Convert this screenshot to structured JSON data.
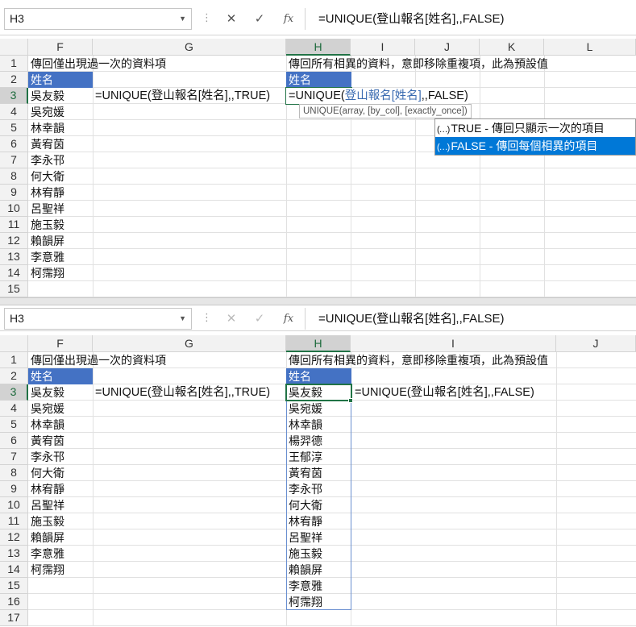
{
  "top": {
    "namebox": "H3",
    "formula": "=UNIQUE(登山報名[姓名],,FALSE)",
    "columns": [
      "F",
      "G",
      "H",
      "I",
      "J",
      "K",
      "L"
    ],
    "rows": [
      "1",
      "2",
      "3",
      "4",
      "5",
      "6",
      "7",
      "8",
      "9",
      "10",
      "11",
      "12",
      "13",
      "14",
      "15"
    ],
    "f1": "傳回僅出現過一次的資料項",
    "h1": "傳回所有相異的資料，意即移除重複項，此為預設值",
    "header_name": "姓名",
    "g3": "=UNIQUE(登山報名[姓名],,TRUE)",
    "h3_prefix": "=UNIQUE(",
    "h3_ref": "登山報名[姓名]",
    "h3_suffix": ",,FALSE)",
    "names": [
      "吳友毅",
      "吳宛媛",
      "林幸韻",
      "黃宥茵",
      "李永邗",
      "何大衛",
      "林宥靜",
      "呂聖祥",
      "施玉毅",
      "賴韻屏",
      "李意雅",
      "柯霈翔"
    ],
    "tooltip": "UNIQUE(array, [by_col], [exactly_once])",
    "autocomplete": [
      {
        "icon": "(…)",
        "label": "TRUE - 傳回只顯示一次的項目"
      },
      {
        "icon": "(…)",
        "label": "FALSE - 傳回每個相異的項目"
      }
    ]
  },
  "bottom": {
    "namebox": "H3",
    "formula": "=UNIQUE(登山報名[姓名],,FALSE)",
    "columns": [
      "F",
      "G",
      "H",
      "I",
      "J"
    ],
    "rows": [
      "1",
      "2",
      "3",
      "4",
      "5",
      "6",
      "7",
      "8",
      "9",
      "10",
      "11",
      "12",
      "13",
      "14",
      "15",
      "16",
      "17"
    ],
    "f1": "傳回僅出現過一次的資料項",
    "h1": "傳回所有相異的資料，意即移除重複項，此為預設值",
    "header_name": "姓名",
    "g3": "=UNIQUE(登山報名[姓名],,TRUE)",
    "i3": "=UNIQUE(登山報名[姓名],,FALSE)",
    "names": [
      "吳友毅",
      "吳宛媛",
      "林幸韻",
      "黃宥茵",
      "李永邗",
      "何大衛",
      "林宥靜",
      "呂聖祥",
      "施玉毅",
      "賴韻屏",
      "李意雅",
      "柯霈翔"
    ],
    "spill": [
      "吳友毅",
      "吳宛媛",
      "林幸韻",
      "楊羿德",
      "王郁淳",
      "黃宥茵",
      "李永邗",
      "何大衛",
      "林宥靜",
      "呂聖祥",
      "施玉毅",
      "賴韻屏",
      "李意雅",
      "柯霈翔"
    ]
  },
  "icons": {
    "cancel": "✕",
    "enter": "✓",
    "fx": "fx",
    "dropdown": "▼",
    "sep": "⋮"
  },
  "colors": {
    "accent": "#217346",
    "header_fill": "#4472c4",
    "autocomplete_highlight": "#0078d7"
  }
}
